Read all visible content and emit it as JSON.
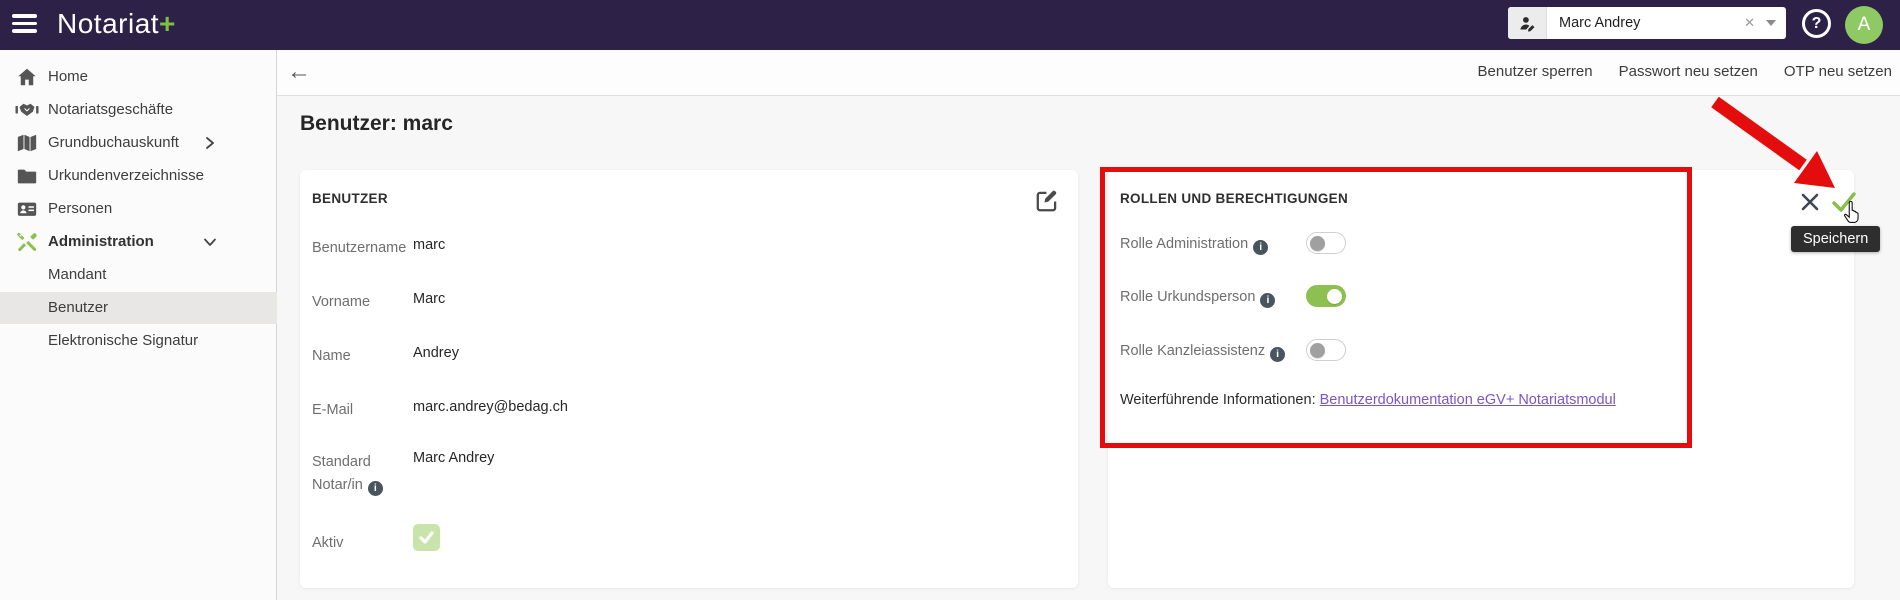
{
  "topbar": {
    "logo_text": "Notariat",
    "logo_plus": "+",
    "user_picker": {
      "value": "Marc Andrey",
      "clear_glyph": "✕"
    },
    "help_glyph": "?",
    "avatar_initial": "A"
  },
  "sidebar": {
    "items": [
      {
        "label": "Home"
      },
      {
        "label": "Notariatsgeschäfte"
      },
      {
        "label": "Grundbuchauskunft"
      },
      {
        "label": "Urkundenverzeichnisse"
      },
      {
        "label": "Personen"
      },
      {
        "label": "Administration"
      },
      {
        "label": "Mandant"
      },
      {
        "label": "Benutzer"
      },
      {
        "label": "Elektronische Signatur"
      }
    ]
  },
  "header": {
    "back_glyph": "←",
    "actions": [
      {
        "label": "Benutzer sperren"
      },
      {
        "label": "Passwort neu setzen"
      },
      {
        "label": "OTP neu setzen"
      }
    ]
  },
  "page": {
    "title": "Benutzer: marc"
  },
  "user_card": {
    "title": "BENUTZER",
    "fields": [
      {
        "label": "Benutzername",
        "value": "marc"
      },
      {
        "label": "Vorname",
        "value": "Marc"
      },
      {
        "label": "Name",
        "value": "Andrey"
      },
      {
        "label": "E-Mail",
        "value": "marc.andrey@bedag.ch"
      },
      {
        "label": "Standard Notar/in",
        "value": "Marc Andrey",
        "has_info": true
      },
      {
        "label": "Aktiv",
        "checked": true
      }
    ]
  },
  "roles_card": {
    "title": "ROLLEN UND BERECHTIGUNGEN",
    "toggles": [
      {
        "label": "Rolle Administration",
        "on": false
      },
      {
        "label": "Rolle Urkundsperson",
        "on": true
      },
      {
        "label": "Rolle Kanzleiassistenz",
        "on": false
      }
    ],
    "info_prefix": "Weiterführende Informationen: ",
    "link_label": "Benutzerdokumentation eGV+ Notariatsmodul",
    "save_tooltip": "Speichern"
  },
  "colors": {
    "topbar_purple": "#2d2148",
    "accent_green": "#8cc152",
    "annotation_red": "#e30d0d",
    "link_purple": "#7a55c8"
  }
}
